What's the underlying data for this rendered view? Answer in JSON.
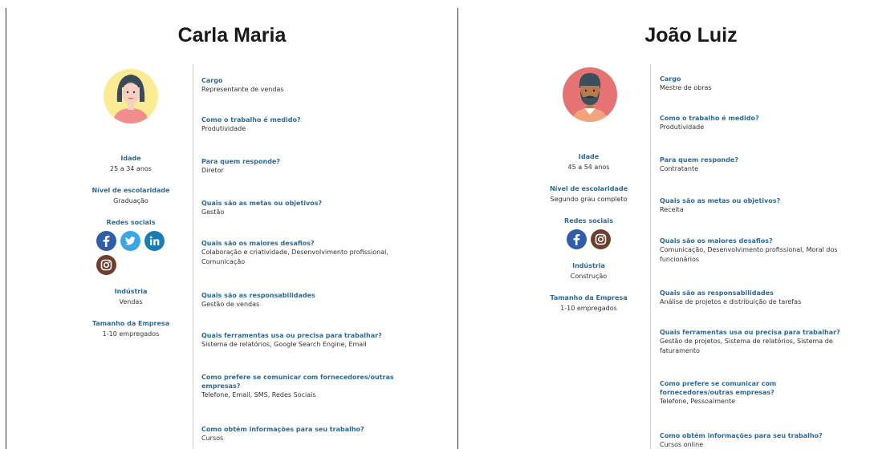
{
  "personas": [
    {
      "name": "Carla Maria",
      "avatar": {
        "skin": "#f6d0c3",
        "bg": "#fbeb94",
        "hair": "#3a4a58",
        "shirt": "#f18d8d"
      },
      "left": [
        {
          "label": "Idade",
          "value": "25 a 34 anos"
        },
        {
          "label": "Nível de escolaridade",
          "value": "Graduação"
        }
      ],
      "social_label": "Redes sociais",
      "social_icons": [
        "facebook-icon",
        "twitter-icon",
        "linkedin-icon",
        "instagram-icon"
      ],
      "left2": [
        {
          "label": "Indústria",
          "value": "Vendas"
        },
        {
          "label": "Tamanho da Empresa",
          "value": "1-10 empregados"
        }
      ],
      "questions": [
        {
          "q": "Cargo",
          "a": "Representante de vendas"
        },
        {
          "q": "Como o trabalho é medido?",
          "a": "Produtividade"
        },
        {
          "q": "Para quem responde?",
          "a": "Diretor"
        },
        {
          "q": "Quais são as metas ou objetivos?",
          "a": "Gestão"
        },
        {
          "q": "Quais são os maiores desafios?",
          "a": "Colaboração e criatividade, Desenvolvimento profissional, Comunicação"
        },
        {
          "q": "Quais são as responsabilidades",
          "a": "Gestão de vendas"
        },
        {
          "q": "Quais ferramentas usa ou precisa para trabalhar?",
          "a": "Sistema de relatórios, Google Search Engine, Email"
        },
        {
          "q": "Como prefere se comunicar com fornecedores/outras empresas?",
          "a": "Telefone, Email, SMS, Redes Sociais"
        },
        {
          "q": "Como obtém informações para seu trabalho?",
          "a": "Cursos"
        }
      ]
    },
    {
      "name": "João Luiz",
      "avatar": {
        "skin": "#b87a4b",
        "bg": "#e57373",
        "hair": "#3c4f5c",
        "shirt": "#f3a37a"
      },
      "left": [
        {
          "label": "Idade",
          "value": "45 a 54 anos"
        },
        {
          "label": "Nível de escolaridade",
          "value": "Segundo grau completo"
        }
      ],
      "social_label": "Redes sociais",
      "social_icons": [
        "facebook-icon",
        "instagram-icon"
      ],
      "left2": [
        {
          "label": "Indústria",
          "value": "Construção"
        },
        {
          "label": "Tamanho da Empresa",
          "value": "1-10 empregados"
        }
      ],
      "questions": [
        {
          "q": "Cargo",
          "a": "Mestre de obras"
        },
        {
          "q": "Como o trabalho é medido?",
          "a": "Produtividade"
        },
        {
          "q": "Para quem responde?",
          "a": "Contratante"
        },
        {
          "q": "Quais são as metas ou objetivos?",
          "a": "Receita"
        },
        {
          "q": "Quais são os maiores desafios?",
          "a": "Comunicação, Desenvolvimento profissional, Moral dos funcionários"
        },
        {
          "q": "Quais são as responsabilidades",
          "a": "Análise de projetos e distribuição de tarefas"
        },
        {
          "q": "Quais ferramentas usa ou precisa para trabalhar?",
          "a": "Gestão de projetos, Sistema de relatórios, Sistema de faturamento"
        },
        {
          "q": "Como prefere se comunicar com fornecedores/outras empresas?",
          "a": "Telefone, Pessoalmente"
        },
        {
          "q": "Como obtém informações para seu trabalho?",
          "a": "Cursos online"
        }
      ]
    }
  ],
  "social_colors": {
    "facebook-icon": "#2f5da8",
    "twitter-icon": "#3aa7e4",
    "linkedin-icon": "#1a7bb5",
    "instagram-icon": "#6d3f2c"
  }
}
